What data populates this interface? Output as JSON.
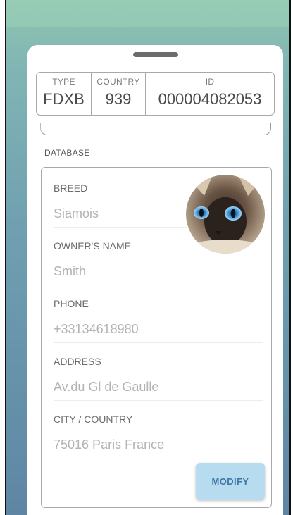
{
  "id_card": {
    "type_label": "TYPE",
    "type_value": "FDXB",
    "country_label": "COUNTRY",
    "country_value": "939",
    "id_label": "ID",
    "id_value": "000004082053"
  },
  "database": {
    "section_label": "DATABASE",
    "fields": [
      {
        "label": "BREED",
        "value": "Siamois"
      },
      {
        "label": "OWNER'S NAME",
        "value": "Smith"
      },
      {
        "label": "PHONE",
        "value": "+33134618980"
      },
      {
        "label": "ADDRESS",
        "value": "Av.du Gl de Gaulle"
      },
      {
        "label": "CITY / COUNTRY",
        "value": "75016 Paris France"
      }
    ],
    "modify_label": "MODIFY"
  },
  "colors": {
    "accent": "#3f77a6",
    "button_bg": "#b8dcef",
    "background_top": "#8fc6b0",
    "background_bottom": "#5e86a4"
  },
  "icons": {
    "drag_handle": "drag-handle-icon",
    "pet_photo": "siamese-cat-photo"
  }
}
